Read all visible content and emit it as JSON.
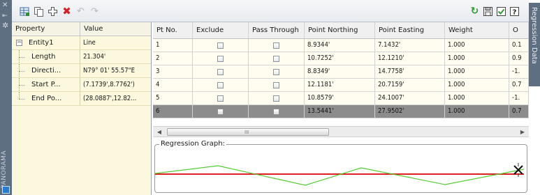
{
  "sidebar": {
    "label": "PANORAMA"
  },
  "right_tab": {
    "label": "Regression Data"
  },
  "properties": {
    "headers": {
      "property": "Property",
      "value": "Value"
    },
    "rows": [
      {
        "key": "Entity1",
        "value": "Line"
      },
      {
        "key": "Length",
        "value": "21.304'"
      },
      {
        "key": "Directi...",
        "value": "N79° 01' 55.57\"E"
      },
      {
        "key": "Start P...",
        "value": "(7.1739',8.7762')"
      },
      {
        "key": "End Po...",
        "value": "(28.0887',12.82..."
      }
    ]
  },
  "grid": {
    "headers": [
      "Pt No.",
      "Exclude",
      "Pass Through",
      "Point Northing",
      "Point Easting",
      "Weight",
      "O"
    ],
    "rows": [
      {
        "pt": "1",
        "northing": "8.9344'",
        "easting": "7.1432'",
        "weight": "1.000",
        "other": "0.1"
      },
      {
        "pt": "2",
        "northing": "10.7252'",
        "easting": "12.1210'",
        "weight": "1.000",
        "other": "0.9"
      },
      {
        "pt": "3",
        "northing": "8.8349'",
        "easting": "14.7758'",
        "weight": "1.000",
        "other": "-1."
      },
      {
        "pt": "4",
        "northing": "12.1181'",
        "easting": "20.7159'",
        "weight": "1.000",
        "other": "0.7"
      },
      {
        "pt": "5",
        "northing": "10.8579'",
        "easting": "24.1007'",
        "weight": "1.000",
        "other": "-1."
      },
      {
        "pt": "6",
        "northing": "13.5441'",
        "easting": "27.9502'",
        "weight": "1.000",
        "other": "0.7"
      }
    ],
    "selected_row": 6
  },
  "scrollbar": {
    "grip": "III"
  },
  "graph": {
    "title": "Regression Graph:",
    "regression_color": "#e02020",
    "data_color": "#55cc33"
  },
  "icons": {
    "toolbar": [
      "table-add-icon",
      "copy-icon",
      "add-icon",
      "delete-icon",
      "undo-icon",
      "redo-icon",
      "refresh-icon",
      "save-icon",
      "accept-icon",
      "help-icon"
    ],
    "strip": [
      "close-icon",
      "auto-hide-icon",
      "properties-icon"
    ]
  }
}
